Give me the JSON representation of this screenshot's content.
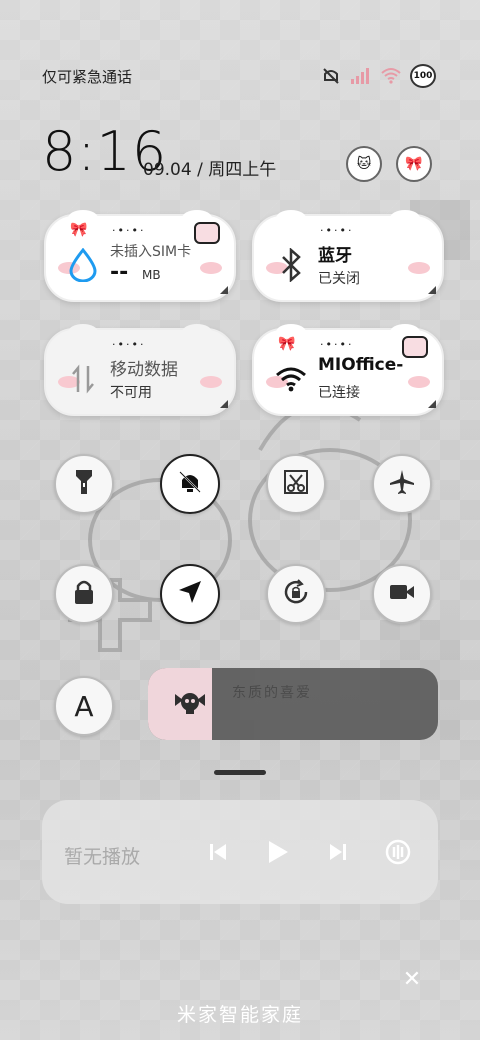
{
  "status_bar": {
    "carrier": "仅可紧急通话",
    "battery": "100"
  },
  "clock": {
    "time": "8:16",
    "date": "09.04 / 周四上午"
  },
  "tiles": {
    "sim": {
      "title": "未插入SIM卡",
      "value": "--",
      "unit": "MB"
    },
    "bluetooth": {
      "title": "蓝牙",
      "status": "已关闭"
    },
    "mobile_data": {
      "title": "移动数据",
      "status": "不可用"
    },
    "wifi": {
      "title": "MIOffice-",
      "status": "已连接"
    }
  },
  "decor_text": "·•·•·",
  "brightness": {
    "label": "东质的喜爱",
    "level": 0.22
  },
  "media": {
    "label": "暂无播放"
  },
  "footer": {
    "label": "米家智能家庭"
  },
  "colors": {
    "accent_blue": "#1e9bf0",
    "blush_pink": "#f8c9d0",
    "slider_fill": "#f3d7dd"
  }
}
